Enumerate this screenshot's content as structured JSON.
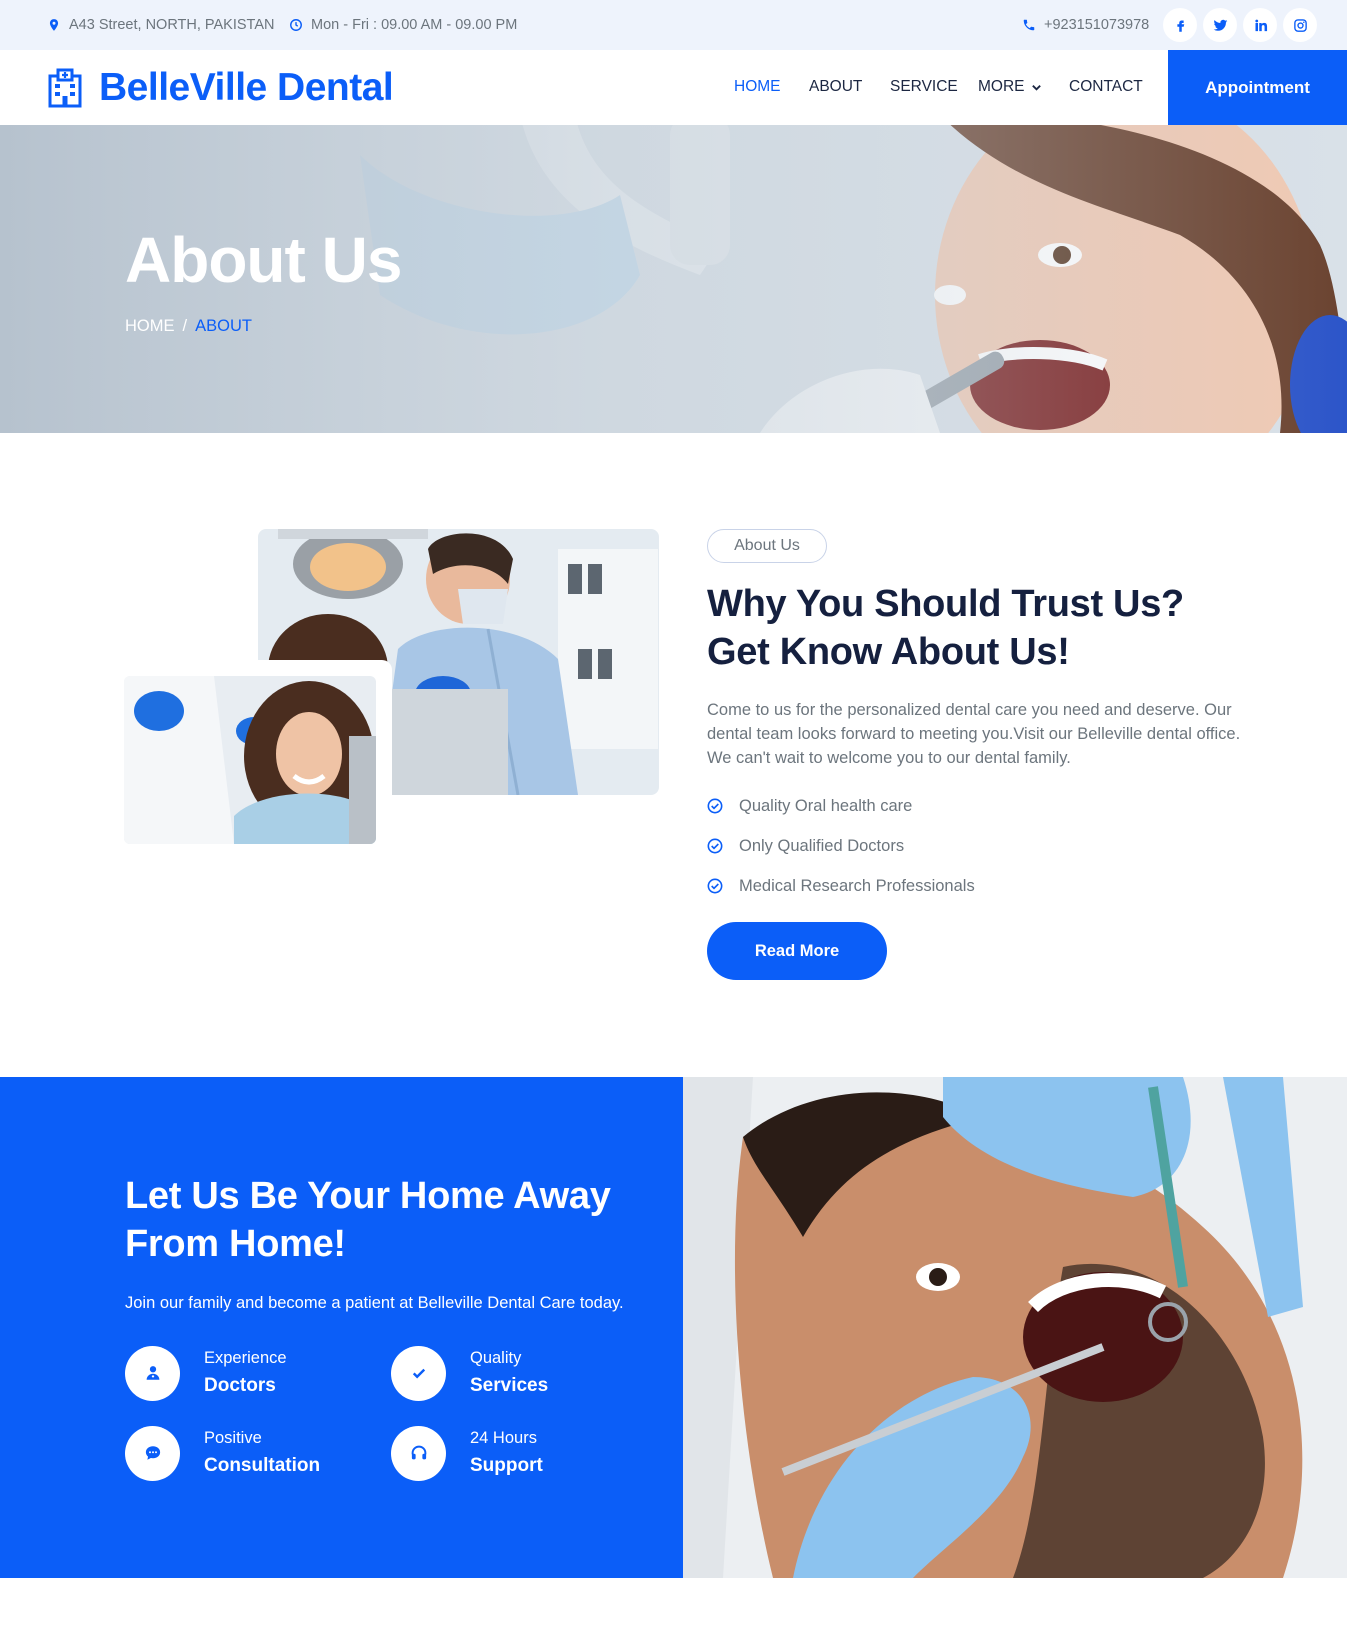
{
  "topbar": {
    "address": "A43 Street, NORTH, PAKISTAN",
    "hours": "Mon - Fri : 09.00 AM - 09.00 PM",
    "phone": "+923151073978",
    "socials": [
      "facebook-icon",
      "twitter-icon",
      "linkedin-icon",
      "instagram-icon"
    ]
  },
  "brand": {
    "name": "BelleVille Dental"
  },
  "nav": {
    "home": "HOME",
    "about": "ABOUT",
    "service": "SERVICE",
    "more": "MORE",
    "contact": "CONTACT",
    "appointment": "Appointment"
  },
  "hero": {
    "title": "About Us",
    "breadcrumb_home": "HOME",
    "breadcrumb_sep": "/",
    "breadcrumb_current": "ABOUT"
  },
  "about": {
    "tag": "About Us",
    "heading_line1": "Why You Should Trust Us?",
    "heading_line2": "Get Know About Us!",
    "paragraph": "Come to us for the personalized dental care you need and deserve. Our dental team looks forward to meeting you.Visit our Belleville dental office. We can't wait to welcome you to our dental family.",
    "checks": [
      "Quality Oral health care",
      "Only Qualified Doctors",
      "Medical Research Professionals"
    ],
    "button": "Read More"
  },
  "features_section": {
    "heading_line1": "Let Us Be Your Home Away",
    "heading_line2": "From Home!",
    "paragraph": "Join our family and become a patient at Belleville Dental Care today.",
    "items": [
      {
        "top": "Experience",
        "bottom": "Doctors",
        "icon": "doctor-icon"
      },
      {
        "top": "Quality",
        "bottom": "Services",
        "icon": "check-icon"
      },
      {
        "top": "Positive",
        "bottom": "Consultation",
        "icon": "chat-icon"
      },
      {
        "top": "24 Hours",
        "bottom": "Support",
        "icon": "headset-icon"
      }
    ]
  },
  "colors": {
    "primary": "#0b5ef8",
    "heading": "#15203f",
    "topbar_bg": "#eef3fc"
  }
}
